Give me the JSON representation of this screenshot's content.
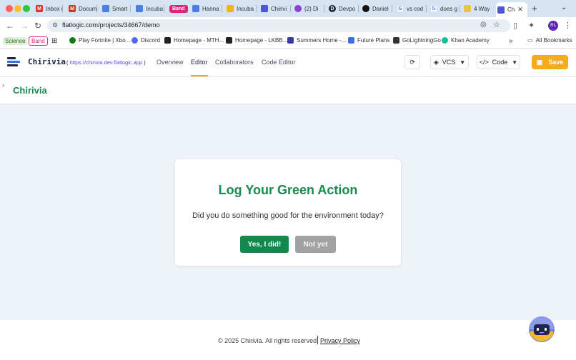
{
  "browser": {
    "tabs": [
      {
        "label": "Inbox (",
        "icon": "gmail-icon",
        "color": "#d93025"
      },
      {
        "label": "Docum",
        "icon": "gmail-icon",
        "color": "#d93025"
      },
      {
        "label": "Smart",
        "icon": "docs-icon",
        "color": "#4a7fe0"
      },
      {
        "label": "Incuba",
        "icon": "docs-icon",
        "color": "#4a7fe0"
      },
      {
        "label": "Band",
        "icon": "band-icon",
        "color": "#e0247a"
      },
      {
        "label": "Hanna",
        "icon": "docs-icon",
        "color": "#4a7fe0"
      },
      {
        "label": "Incuba",
        "icon": "slides-icon",
        "color": "#f2b705"
      },
      {
        "label": "Chirivi",
        "icon": "chirivia-icon",
        "color": "#4b57d6"
      },
      {
        "label": "(2) Di",
        "icon": "notification-icon",
        "color": "#8b3fd6"
      },
      {
        "label": "Devpo",
        "icon": "devpost-icon",
        "color": "#1a2a3a"
      },
      {
        "label": "Daniel",
        "icon": "github-icon",
        "color": "#111111"
      },
      {
        "label": "vs cod",
        "icon": "google-icon",
        "color": "#4285f4"
      },
      {
        "label": "does g",
        "icon": "google-icon",
        "color": "#4285f4"
      },
      {
        "label": "4 Way",
        "icon": "folder-icon",
        "color": "#e8c34a"
      },
      {
        "label": "Ch",
        "icon": "chirivia-icon",
        "color": "#4b57d6"
      }
    ],
    "url": "flatlogic.com/projects/34667/demo",
    "avatar_text": "RL",
    "bookmarks": {
      "chip_science": "Science",
      "chip_band": "Band",
      "items": [
        {
          "label": "Play Fortnite | Xbo...",
          "color": "#107c10"
        },
        {
          "label": "Discord",
          "color": "#5865f2"
        },
        {
          "label": "Homepage - MTH...",
          "color": "#222222"
        },
        {
          "label": "Homepage - LKBB...",
          "color": "#222222"
        },
        {
          "label": "Summers Home -...",
          "color": "#3b3ba8"
        },
        {
          "label": "Future Plans",
          "color": "#3d6fe0"
        },
        {
          "label": "GoLightningGo",
          "color": "#333333"
        },
        {
          "label": "Khan Academy",
          "color": "#14bf96"
        }
      ],
      "all_bookmarks": "All Bookmarks"
    }
  },
  "header": {
    "brand": "Chirivia",
    "brand_url": "https://chirivia.dev.flatlogic.app",
    "nav": [
      {
        "label": "Overview",
        "active": false
      },
      {
        "label": "Editor",
        "active": true
      },
      {
        "label": "Collaborators",
        "active": false
      },
      {
        "label": "Code Editor",
        "active": false
      }
    ],
    "vcs_label": "VCS",
    "code_label": "Code",
    "save_label": "Save",
    "accent": "#f5ab1b"
  },
  "page": {
    "title": "Chirivia",
    "card": {
      "title": "Log Your Green Action",
      "question": "Did you do something good for the environment today?",
      "yes_label": "Yes, I did!",
      "no_label": "Not yet"
    },
    "footer": {
      "copyright": "© 2025 Chirivia. All rights reserved.",
      "privacy": "Privacy Policy"
    }
  }
}
